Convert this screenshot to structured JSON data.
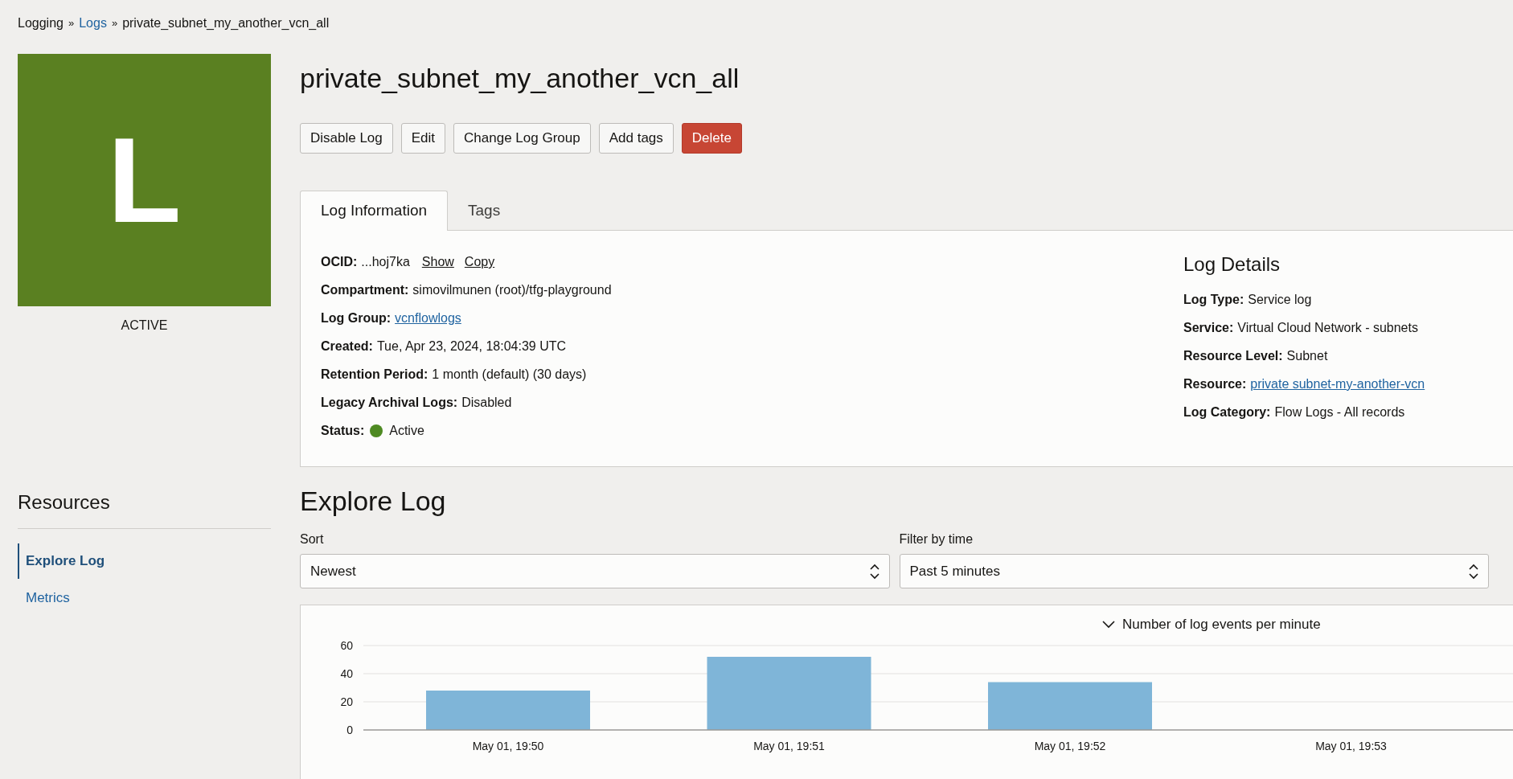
{
  "breadcrumb_separator": "»",
  "breadcrumb": [
    {
      "label": "Logging",
      "kind": "text"
    },
    {
      "label": "Logs",
      "kind": "link"
    },
    {
      "label": "private_subnet_my_another_vcn_all",
      "kind": "text"
    }
  ],
  "badge": {
    "letter": "L",
    "state": "ACTIVE"
  },
  "title": "private_subnet_my_another_vcn_all",
  "actions": [
    {
      "label": "Disable Log",
      "kind": "default"
    },
    {
      "label": "Edit",
      "kind": "default"
    },
    {
      "label": "Change Log Group",
      "kind": "default"
    },
    {
      "label": "Add tags",
      "kind": "default"
    },
    {
      "label": "Delete",
      "kind": "danger"
    }
  ],
  "tabs": [
    {
      "label": "Log Information",
      "selected": true
    },
    {
      "label": "Tags",
      "selected": false
    }
  ],
  "info": [
    {
      "label": "OCID:",
      "value": "...hoj7ka",
      "kind": "ocid",
      "links": [
        "Show",
        "Copy"
      ]
    },
    {
      "label": "Compartment:",
      "value": "simovilmunen (root)/tfg-playground",
      "kind": "text"
    },
    {
      "label": "Log Group:",
      "value": "vcnflowlogs",
      "kind": "link"
    },
    {
      "label": "Created:",
      "value": "Tue, Apr 23, 2024, 18:04:39 UTC",
      "kind": "text"
    },
    {
      "label": "Retention Period:",
      "value": "1 month (default) (30 days)",
      "kind": "text"
    },
    {
      "label": "Legacy Archival Logs:",
      "value": "Disabled",
      "kind": "text"
    },
    {
      "label": "Status:",
      "value": "Active",
      "kind": "status",
      "color": "#4e8a22"
    }
  ],
  "details": {
    "title": "Log Details",
    "rows": [
      {
        "label": "Log Type:",
        "value": "Service log",
        "kind": "text"
      },
      {
        "label": "Service:",
        "value": "Virtual Cloud Network - subnets",
        "kind": "text"
      },
      {
        "label": "Resource Level:",
        "value": "Subnet",
        "kind": "text"
      },
      {
        "label": "Resource:",
        "value": "private subnet-my-another-vcn",
        "kind": "link"
      },
      {
        "label": "Log Category:",
        "value": "Flow Logs - All records",
        "kind": "text"
      }
    ]
  },
  "sidebar": {
    "title": "Resources",
    "items": [
      {
        "label": "Explore Log",
        "selected": true
      },
      {
        "label": "Metrics",
        "selected": false
      }
    ]
  },
  "explore": {
    "title": "Explore Log",
    "filters": [
      {
        "label": "Sort",
        "value": "Newest"
      },
      {
        "label": "Filter by time",
        "value": "Past 5 minutes"
      }
    ]
  },
  "chart_data": {
    "type": "bar",
    "categories": [
      "May 01, 19:50",
      "May 01, 19:51",
      "May 01, 19:52",
      "May 01, 19:53"
    ],
    "series": [
      {
        "name": "Number of log events per minute",
        "color": "#7fb5d8",
        "values": [
          28,
          52,
          34,
          0
        ]
      }
    ],
    "ylim": [
      0,
      60
    ],
    "yticks": [
      0,
      20,
      40,
      60
    ]
  }
}
